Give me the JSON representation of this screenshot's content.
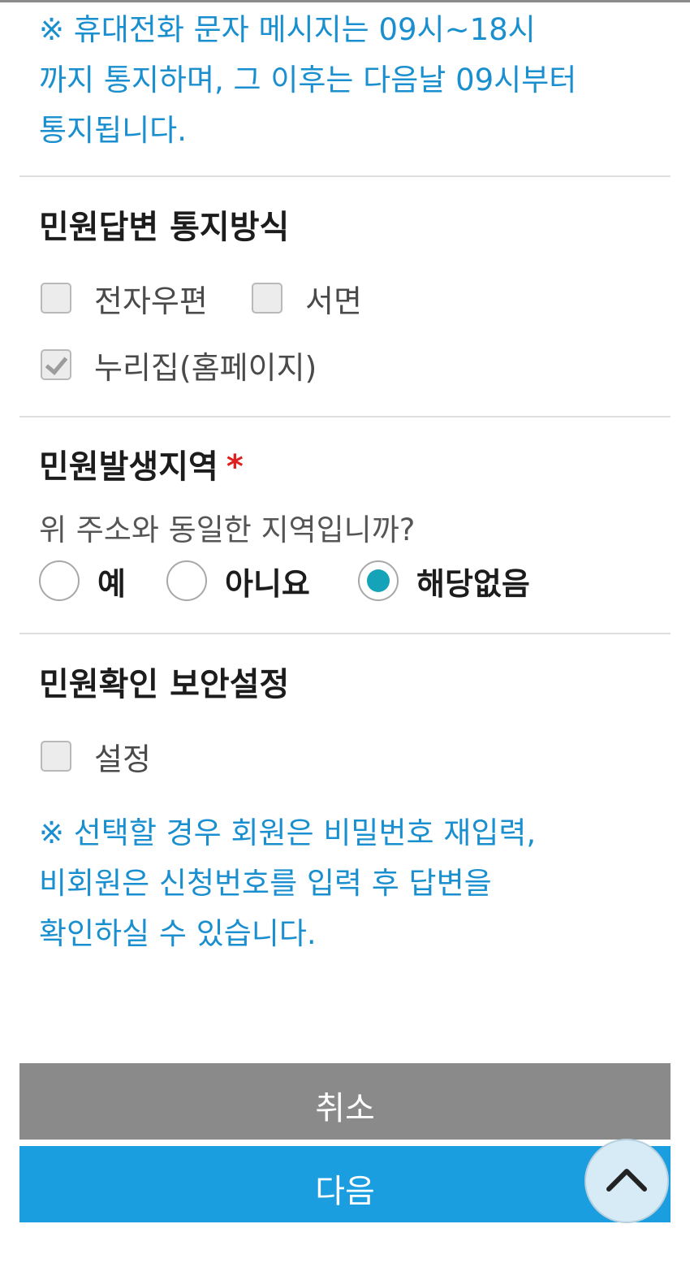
{
  "notice_sms": {
    "lines": [
      "※ 휴대전화 문자 메시지는 09시~18시",
      "까지 통지하며, 그 이후는 다음날 09시부터",
      "통지됩니다."
    ]
  },
  "reply_method": {
    "heading": "민원답변 통지방식",
    "options": [
      {
        "label": "전자우편",
        "checked": false
      },
      {
        "label": "서면",
        "checked": false
      },
      {
        "label": "누리집(홈페이지)",
        "checked": true
      }
    ]
  },
  "occurrence_region": {
    "heading": "민원발생지역",
    "required_mark": "*",
    "question": "위 주소와 동일한 지역입니까?",
    "options": [
      {
        "label": "예",
        "selected": false
      },
      {
        "label": "아니요",
        "selected": false
      },
      {
        "label": "해당없음",
        "selected": true
      }
    ]
  },
  "security": {
    "heading": "민원확인 보안설정",
    "option": {
      "label": "설정",
      "checked": false
    },
    "notice_lines": [
      "※ 선택할 경우 회원은 비밀번호 재입력,",
      "비회원은 신청번호를 입력 후 답변을",
      "확인하실 수 있습니다."
    ]
  },
  "buttons": {
    "cancel": "취소",
    "next": "다음"
  },
  "colors": {
    "notice_text": "#1a8fcf",
    "radio_accent": "#14a3b8",
    "cancel_bg": "#8a8a8a",
    "next_bg": "#1a9ee0",
    "required": "#e02020"
  },
  "icons": {
    "scroll_top": "chevron-up-icon"
  }
}
